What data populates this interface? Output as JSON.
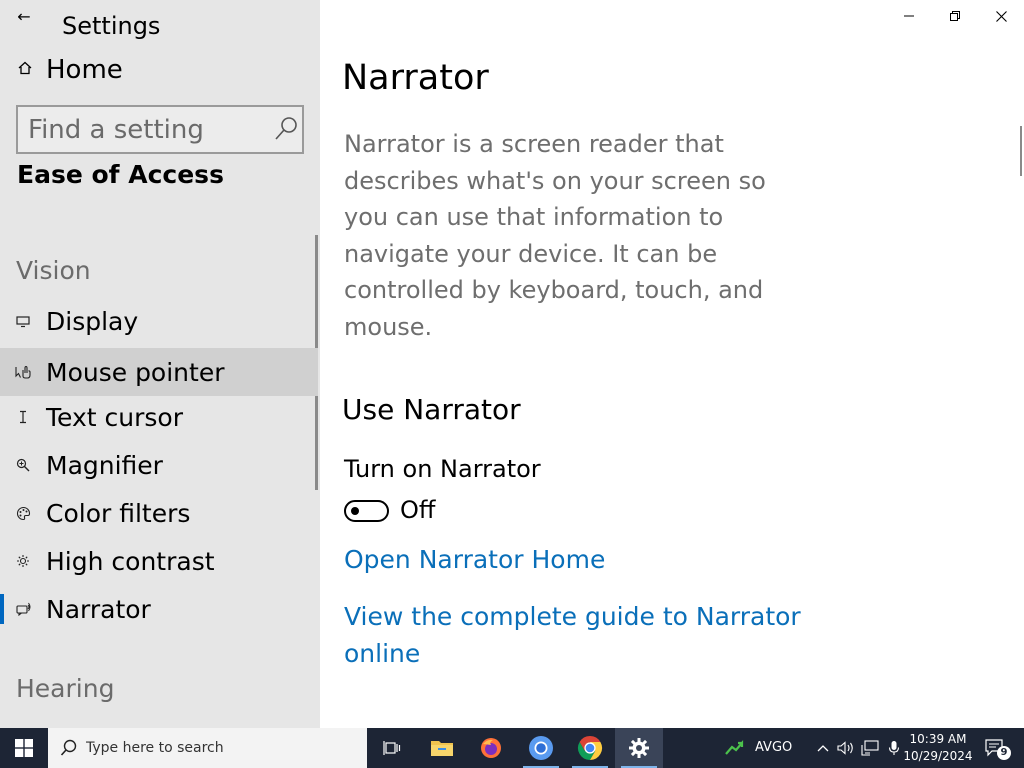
{
  "app": {
    "title": "Settings",
    "back_icon": "back-arrow-icon"
  },
  "sidebar": {
    "home_label": "Home",
    "search_placeholder": "Find a setting",
    "section_title": "Ease of Access",
    "groups": [
      {
        "heading": "Vision",
        "items": [
          {
            "label": "Display",
            "icon": "display-icon"
          },
          {
            "label": "Mouse pointer",
            "icon": "mouse-pointer-icon"
          },
          {
            "label": "Text cursor",
            "icon": "text-cursor-icon"
          },
          {
            "label": "Magnifier",
            "icon": "magnifier-icon"
          },
          {
            "label": "Color filters",
            "icon": "color-filters-icon"
          },
          {
            "label": "High contrast",
            "icon": "high-contrast-icon"
          },
          {
            "label": "Narrator",
            "icon": "narrator-icon",
            "selected": true
          }
        ]
      },
      {
        "heading": "Hearing",
        "items": []
      }
    ],
    "accent_color": "#0067c0"
  },
  "main": {
    "title": "Narrator",
    "description": "Narrator is a screen reader that describes what's on your screen so you can use that information to navigate your device. It can be controlled by keyboard, touch, and mouse.",
    "section_heading": "Use Narrator",
    "setting_label": "Turn on Narrator",
    "toggle_state": "Off",
    "links": [
      "Open Narrator Home",
      "View the complete guide to Narrator online"
    ],
    "link_color": "#0a6fb9"
  },
  "taskbar": {
    "search_placeholder": "Type here to search",
    "apps": [
      "task-view-icon",
      "file-explorer-icon",
      "firefox-icon",
      "chromium-icon",
      "chrome-icon",
      "settings-gear-icon"
    ],
    "ticker": "AVGO",
    "time": "10:39 AM",
    "date": "10/29/2024",
    "notification_count": "9"
  }
}
